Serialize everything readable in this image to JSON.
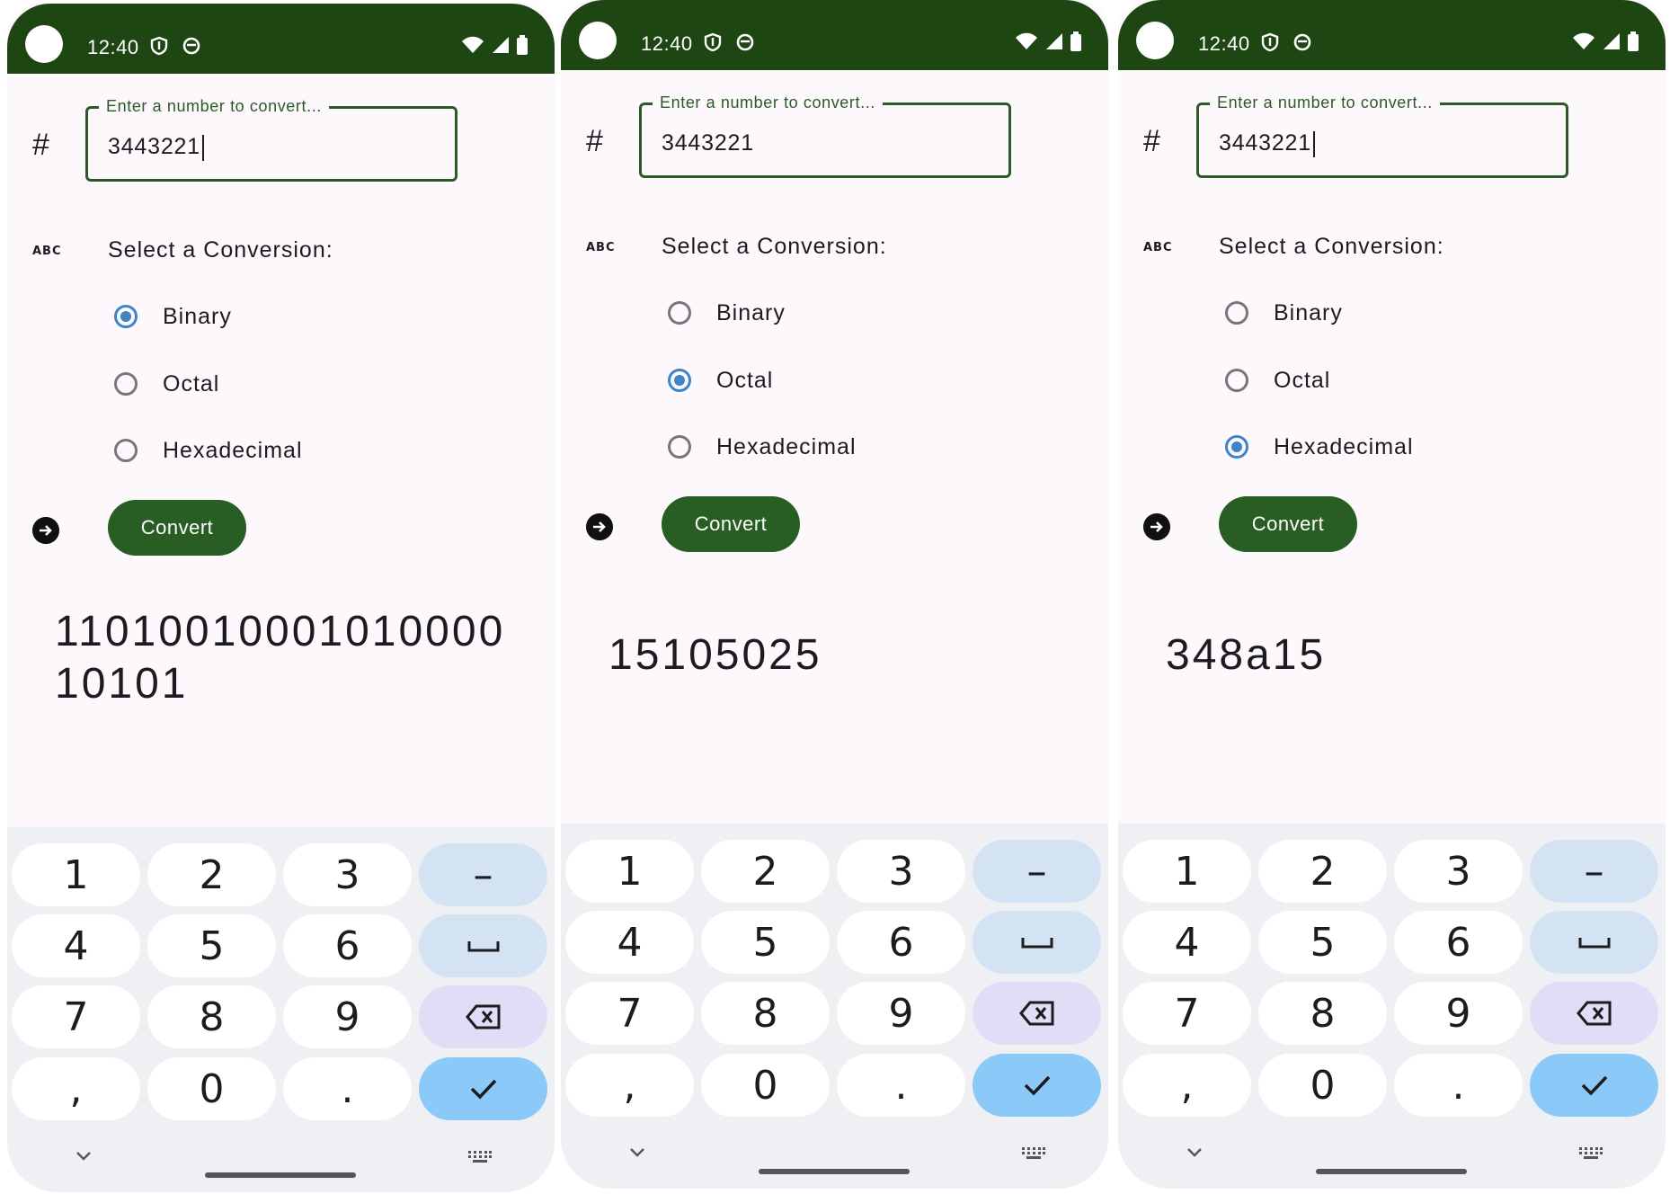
{
  "screens": [
    {
      "status_time": "12:40",
      "input_label": "Enter a number to convert...",
      "input_value": "3443221",
      "select_label": "Select a Conversion:",
      "options": [
        "Binary",
        "Octal",
        "Hexadecimal"
      ],
      "selected_option": "Binary",
      "button_label": "Convert",
      "result": "11010010001010000 10101"
    },
    {
      "status_time": "12:40",
      "input_label": "Enter a number to convert...",
      "input_value": "3443221",
      "select_label": "Select a Conversion:",
      "options": [
        "Binary",
        "Octal",
        "Hexadecimal"
      ],
      "selected_option": "Octal",
      "button_label": "Convert",
      "result": "15105025"
    },
    {
      "status_time": "12:40",
      "input_label": "Enter a number to convert...",
      "input_value": "3443221",
      "select_label": "Select a Conversion:",
      "options": [
        "Binary",
        "Octal",
        "Hexadecimal"
      ],
      "selected_option": "Hexadecimal",
      "button_label": "Convert",
      "result": "348a15"
    }
  ],
  "keyboard": {
    "rows": [
      [
        "1",
        "2",
        "3",
        "–"
      ],
      [
        "4",
        "5",
        "6",
        "space-icon"
      ],
      [
        "7",
        "8",
        "9",
        "backspace-icon"
      ],
      [
        ",",
        "0",
        ".",
        "check-icon"
      ]
    ]
  },
  "colors": {
    "status_bar": "#1d4613",
    "primary": "#285d24",
    "radio_selected": "#3d84c8",
    "keyboard_bg": "#eff0f3",
    "key_action": "#8bcaf8"
  }
}
